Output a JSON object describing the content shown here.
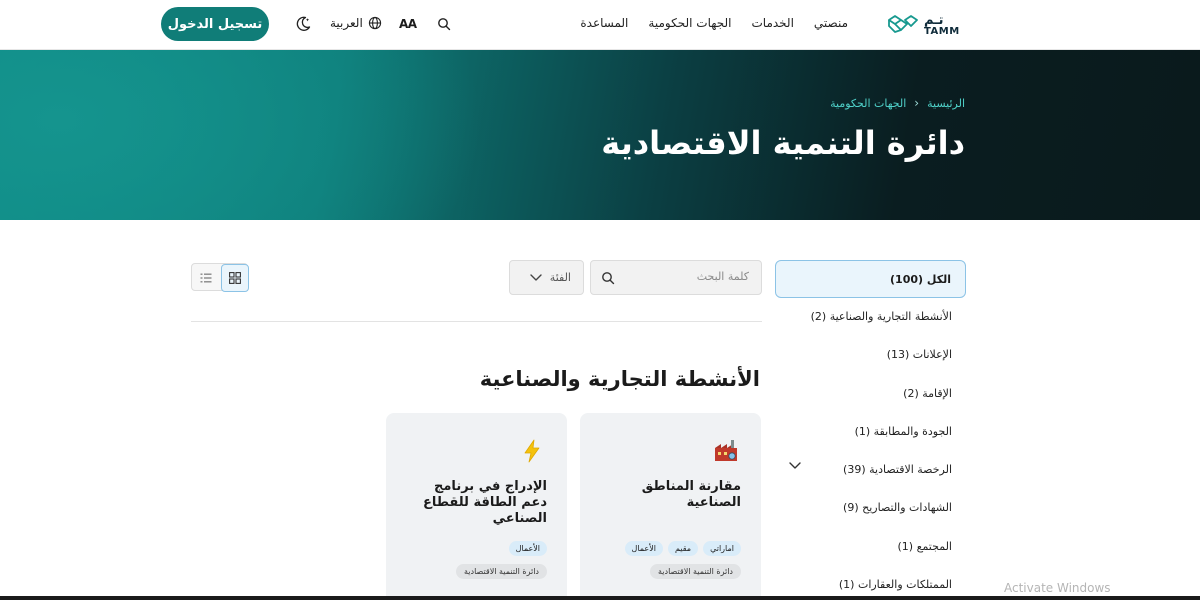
{
  "header": {
    "logo_ar": "تـم",
    "logo_en": "TAMM",
    "nav": [
      "منصتي",
      "الخدمات",
      "الجهات الحكومية",
      "المساعدة"
    ],
    "language": "العربية",
    "text_size": "AA",
    "login": "تسجيل الدخول"
  },
  "hero": {
    "breadcrumbs": [
      "الرئيسية",
      "الجهات الحكومية"
    ],
    "title": "دائرة التنمية الاقتصادية"
  },
  "sidebar": {
    "categories": [
      "الكل (100)",
      "الأنشطة التجارية والصناعية (2)",
      "الإعلانات (13)",
      "الإقامة (2)",
      "الجودة والمطابقة (1)",
      "الرخصة الاقتصادية (39)",
      "الشهادات والتصاريح (9)",
      "المجتمع (1)",
      "الممتلكات والعقارات (1)"
    ]
  },
  "toolbar": {
    "search_placeholder": "كلمة البحث",
    "filter_label": "الفئة"
  },
  "section": {
    "title": "الأنشطة التجارية والصناعية"
  },
  "cards": [
    {
      "title": "مقارنة المناطق الصناعية",
      "icon": "factory-icon",
      "tags": [
        "اماراتي",
        "مقيم",
        "الأعمال"
      ],
      "entity": "دائرة التنمية الاقتصادية"
    },
    {
      "title": "الإدراج في برنامج دعم الطاقة للقطاع الصناعي",
      "icon": "lightning-icon",
      "tags": [
        "الأعمال"
      ],
      "entity": "دائرة التنمية الاقتصادية"
    }
  ],
  "os_watermark": "Activate Windows",
  "colors": {
    "primary": "#107d78",
    "active_bg": "#eaf5fc",
    "active_border": "#8cc3e6",
    "card_bg": "#f0f2f4"
  }
}
